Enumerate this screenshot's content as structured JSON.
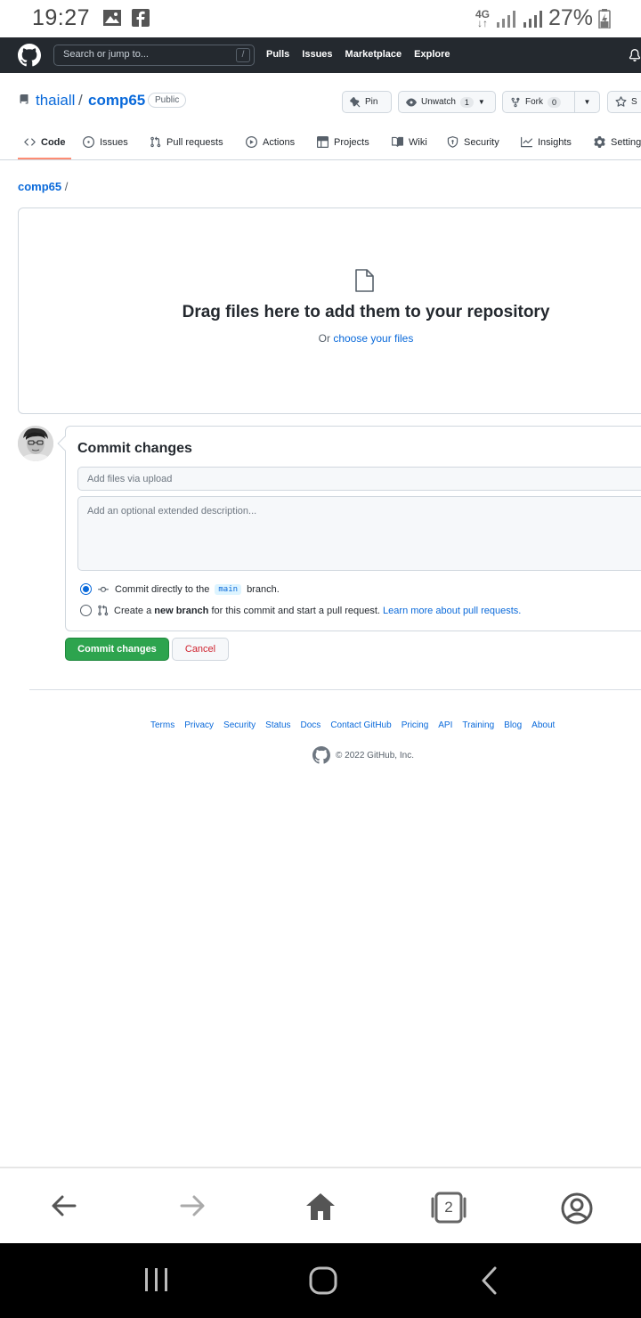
{
  "status_bar": {
    "time": "19:27",
    "network": "4G",
    "battery": "27%"
  },
  "header": {
    "search_placeholder": "Search or jump to...",
    "search_shortcut": "/",
    "nav": [
      "Pulls",
      "Issues",
      "Marketplace",
      "Explore"
    ]
  },
  "repo": {
    "owner": "thaiall",
    "separator": "/",
    "name": "comp65",
    "visibility": "Public",
    "pin_label": "Pin",
    "unwatch_label": "Unwatch",
    "unwatch_count": "1",
    "fork_label": "Fork",
    "fork_count": "0"
  },
  "tabs": [
    {
      "label": "Code",
      "icon": "code-icon"
    },
    {
      "label": "Issues",
      "icon": "issue-icon"
    },
    {
      "label": "Pull requests",
      "icon": "pull-request-icon"
    },
    {
      "label": "Actions",
      "icon": "play-icon"
    },
    {
      "label": "Projects",
      "icon": "table-icon"
    },
    {
      "label": "Wiki",
      "icon": "book-icon"
    },
    {
      "label": "Security",
      "icon": "shield-icon"
    },
    {
      "label": "Insights",
      "icon": "graph-icon"
    },
    {
      "label": "Settings",
      "icon": "gear-icon"
    }
  ],
  "breadcrumb": {
    "repo": "comp65",
    "separator": "/"
  },
  "dropzone": {
    "title": "Drag files here to add them to your repository",
    "prefix": "Or",
    "link": "choose your files"
  },
  "commit": {
    "title": "Commit changes",
    "summary_placeholder": "Add files via upload",
    "description_placeholder": "Add an optional extended description...",
    "option_direct_prefix": "Commit directly to the",
    "branch": "main",
    "option_direct_suffix": "branch.",
    "option_new_prefix": "Create a",
    "option_new_bold": "new branch",
    "option_new_middle": "for this commit and start a pull request.",
    "option_new_link": "Learn more about pull requests.",
    "commit_button": "Commit changes",
    "cancel_button": "Cancel"
  },
  "footer": {
    "links": [
      "Terms",
      "Privacy",
      "Security",
      "Status",
      "Docs",
      "Contact GitHub",
      "Pricing",
      "API",
      "Training",
      "Blog",
      "About"
    ],
    "copyright": "© 2022 GitHub, Inc."
  },
  "browser": {
    "tab_count": "2"
  },
  "colors": {
    "header_bg": "#24292f",
    "link": "#0969da",
    "primary_button": "#2da44e",
    "danger": "#cf222e",
    "tab_underline": "#fd8c73"
  }
}
